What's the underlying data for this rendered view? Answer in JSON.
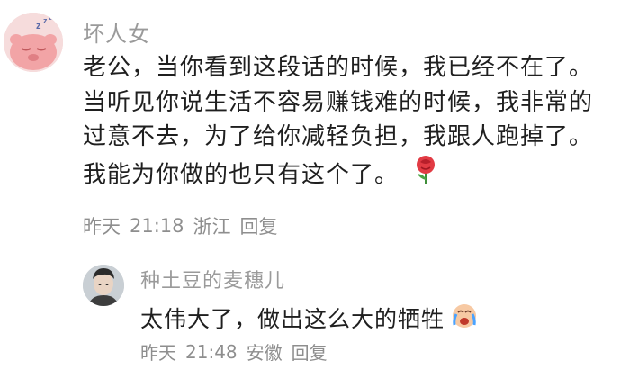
{
  "comments": [
    {
      "username": "坏人女",
      "lines": [
        "老公，当你看到这段话的时候，我已经不在了。",
        "当听见你说生活不容易赚钱难的时候，我非常的",
        "过意不去，为了给你减轻负担，我跟人跑掉了。",
        "我能为你做的也只有这个了。"
      ],
      "emoji": "rose-emoji",
      "date": "昨天",
      "time": "21:18",
      "location": "浙江",
      "reply_label": "回复"
    },
    {
      "username": "种土豆的麦穗儿",
      "text": "太伟大了，做出这么大的牺牲",
      "emoji": "crying-face-emoji",
      "date": "昨天",
      "time": "21:48",
      "location": "安徽",
      "reply_label": "回复"
    }
  ],
  "colors": {
    "username": "#9a9a9a",
    "meta": "#8e8e8e",
    "text": "#1f1f1f",
    "avatar1_bg": "#f3d3d3",
    "avatar1_face": "#f4a5a8"
  }
}
